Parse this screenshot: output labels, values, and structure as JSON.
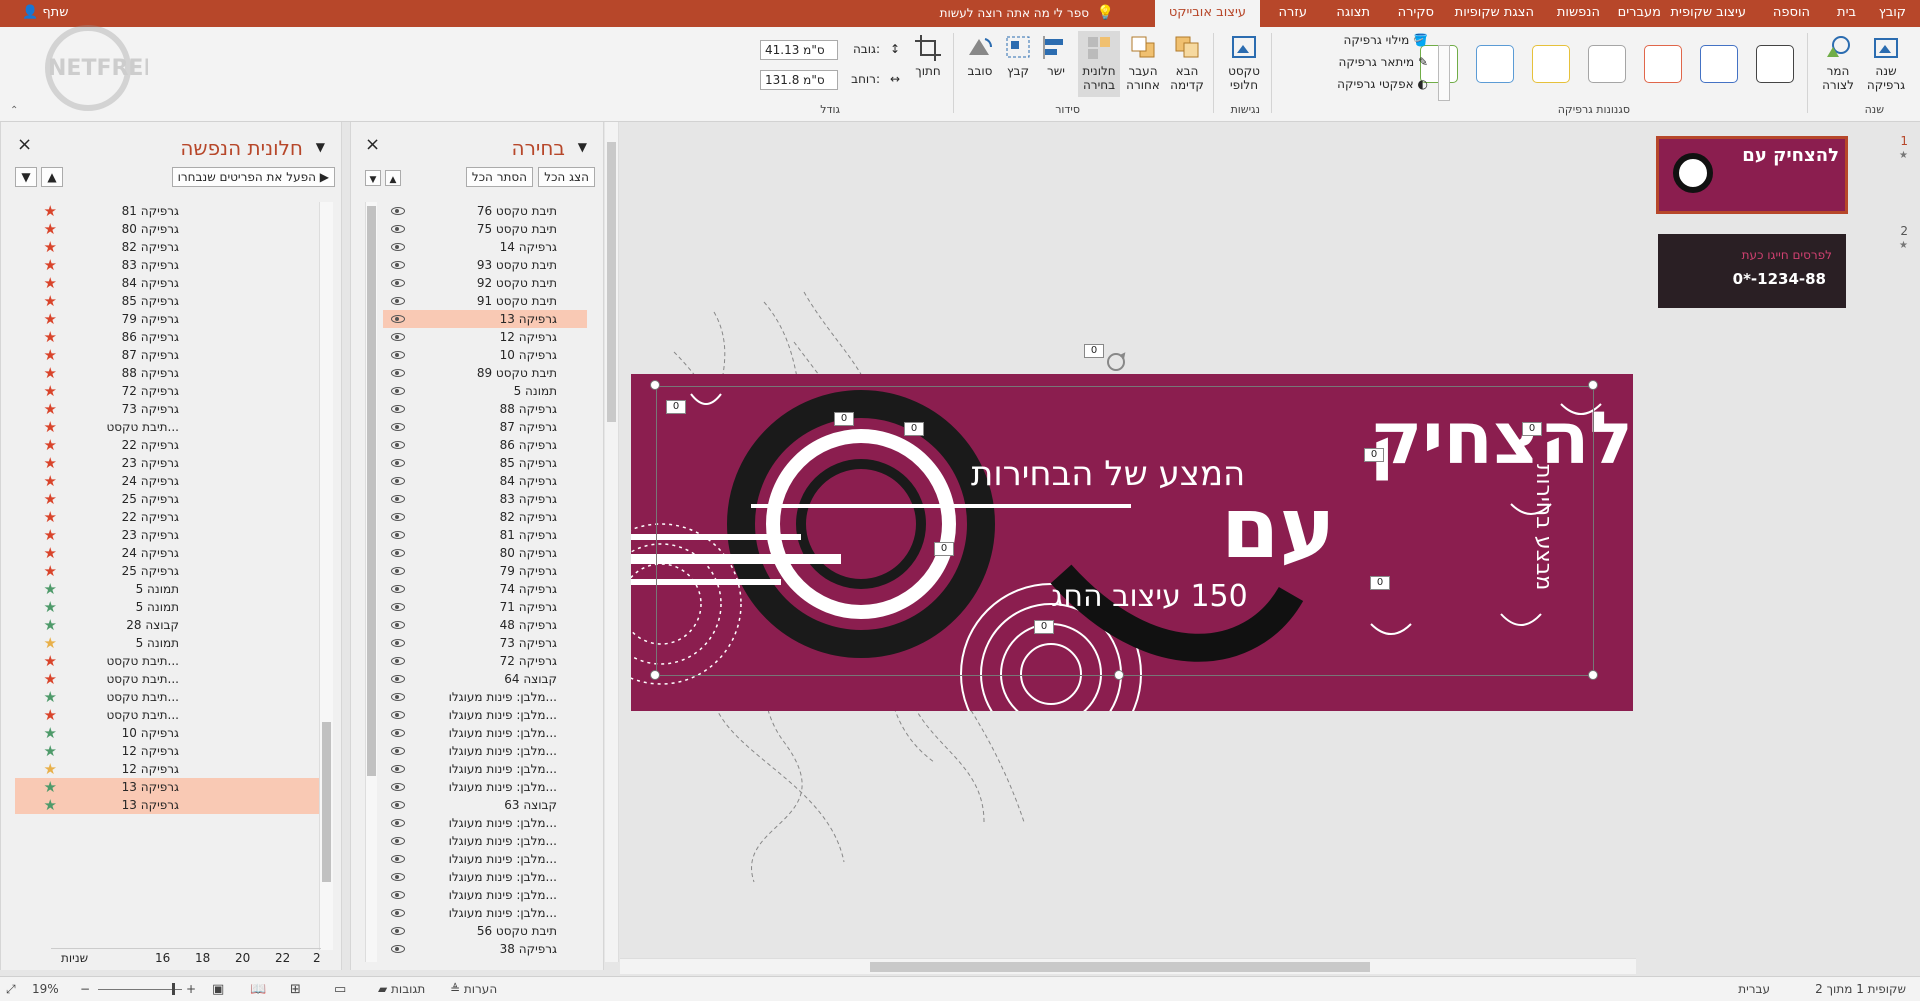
{
  "tabs": {
    "file": "קובץ",
    "home": "בית",
    "insert": "הוספה",
    "design": "עיצוב שקופית",
    "transitions": "מעברים",
    "animations": "הנפשות",
    "slideshow": "הצגת שקופיות",
    "review": "סקירה",
    "view": "תצוגה",
    "help": "עזרה",
    "format": "עיצוב אובייקט",
    "tell_me": "ספר לי מה אתה רוצה לעשות",
    "share": "שתף"
  },
  "ribbon": {
    "change_graphic": "שנה גרפיקה",
    "convert_to_shape": "המר לצורה",
    "change_group": "שנה",
    "fill": "מילוי גרפיקה",
    "outline": "מיתאר גרפיקה",
    "effects": "אפקטי גרפיקה",
    "styles_group": "סגנונות גרפיקה",
    "alt_text": "טקסט חלופי",
    "accessibility_group": "נגישות",
    "bring_forward": "הבא קדימה",
    "send_backward": "העבר אחורה",
    "selection_pane": "חלונית בחירה",
    "align": "ישר",
    "group": "קבץ",
    "rotate": "סובב",
    "arrange_group": "סידור",
    "crop": "חתוך",
    "height_label": "גובה:",
    "height_value": "41.13 ס\"מ",
    "width_label": "רוחב:",
    "width_value": "131.8 ס\"מ",
    "size_group": "גודל",
    "style_colors": [
      "#444444",
      "#4472c4",
      "#e0664a",
      "#a5a5a5",
      "#e6c13b",
      "#5b9bd5",
      "#70ad47"
    ]
  },
  "selection_pane": {
    "title": "בחירה",
    "show_all": "הצג הכל",
    "hide_all": "הסתר הכל",
    "items": [
      "תיבת טקסט 76",
      "תיבת טקסט 75",
      "גרפיקה 14",
      "תיבת טקסט 93",
      "תיבת טקסט 92",
      "תיבת טקסט 91",
      "גרפיקה 13",
      "גרפיקה 12",
      "גרפיקה 10",
      "תיבת טקסט 89",
      "תמונה 5",
      "גרפיקה 88",
      "גרפיקה 87",
      "גרפיקה 86",
      "גרפיקה 85",
      "גרפיקה 84",
      "גרפיקה 83",
      "גרפיקה 82",
      "גרפיקה 81",
      "גרפיקה 80",
      "גרפיקה 79",
      "גרפיקה 74",
      "גרפיקה 71",
      "גרפיקה 48",
      "גרפיקה 73",
      "גרפיקה 72",
      "קבוצה 64",
      "מלבן: פינות מעוגלו...",
      "מלבן: פינות מעוגלו...",
      "מלבן: פינות מעוגלו...",
      "מלבן: פינות מעוגלו...",
      "מלבן: פינות מעוגלו...",
      "מלבן: פינות מעוגלו...",
      "קבוצה 63",
      "מלבן: פינות מעוגלו...",
      "מלבן: פינות מעוגלו...",
      "מלבן: פינות מעוגלו...",
      "מלבן: פינות מעוגלו...",
      "מלבן: פינות מעוגלו...",
      "מלבן: פינות מעוגלו...",
      "תיבת טקסט 56",
      "גרפיקה 38"
    ],
    "selected_index": 6
  },
  "animation_pane": {
    "title": "חלונית הנפשה",
    "play_selected": "הפעל את הפריטים שנבחרו",
    "items": [
      {
        "label": "גרפיקה 81",
        "star": "#d9442b"
      },
      {
        "label": "גרפיקה 80",
        "star": "#d9442b"
      },
      {
        "label": "גרפיקה 82",
        "star": "#d9442b"
      },
      {
        "label": "גרפיקה 83",
        "star": "#d9442b"
      },
      {
        "label": "גרפיקה 84",
        "star": "#d9442b"
      },
      {
        "label": "גרפיקה 85",
        "star": "#d9442b"
      },
      {
        "label": "גרפיקה 79",
        "star": "#d9442b"
      },
      {
        "label": "גרפיקה 86",
        "star": "#d9442b"
      },
      {
        "label": "גרפיקה 87",
        "star": "#d9442b"
      },
      {
        "label": "גרפיקה 88",
        "star": "#d9442b"
      },
      {
        "label": "גרפיקה 72",
        "star": "#d9442b"
      },
      {
        "label": "גרפיקה 73",
        "star": "#d9442b"
      },
      {
        "label": "תיבת טקסט...",
        "star": "#d9442b"
      },
      {
        "label": "גרפיקה 22",
        "star": "#d9442b"
      },
      {
        "label": "גרפיקה 23",
        "star": "#d9442b"
      },
      {
        "label": "גרפיקה 24",
        "star": "#d9442b"
      },
      {
        "label": "גרפיקה 25",
        "star": "#d9442b"
      },
      {
        "label": "גרפיקה 22",
        "star": "#d9442b"
      },
      {
        "label": "גרפיקה 23",
        "star": "#d9442b"
      },
      {
        "label": "גרפיקה 24",
        "star": "#d9442b"
      },
      {
        "label": "גרפיקה 25",
        "star": "#d9442b"
      },
      {
        "label": "תמונה 5",
        "star": "#4e9a6a"
      },
      {
        "label": "תמונה 5",
        "star": "#4e9a6a"
      },
      {
        "label": "קבוצה 28",
        "star": "#4e9a6a"
      },
      {
        "label": "תמונה 5",
        "star": "#e8b04a"
      },
      {
        "label": "תיבת טקסט...",
        "star": "#d9442b"
      },
      {
        "label": "תיבת טקסט...",
        "star": "#d9442b"
      },
      {
        "label": "תיבת טקסט...",
        "star": "#4e9a6a"
      },
      {
        "label": "תיבת טקסט...",
        "star": "#d9442b"
      },
      {
        "label": "גרפיקה 10",
        "star": "#4e9a6a"
      },
      {
        "label": "גרפיקה 12",
        "star": "#4e9a6a"
      },
      {
        "label": "גרפיקה 12",
        "star": "#e8b04a"
      },
      {
        "label": "גרפיקה 13",
        "star": "#4e9a6a"
      },
      {
        "label": "גרפיקה 13",
        "star": "#4e9a6a"
      }
    ],
    "timeline_label": "שניות",
    "timeline_ticks": [
      "16",
      "18",
      "20",
      "22",
      "2"
    ]
  },
  "slide": {
    "title_line1": "להצחיק",
    "title_line2": "עם",
    "subtitle": "המצע של הבחירות",
    "side_text": "מבצע בחירות",
    "line3": "150 עיצוב החג",
    "small_label": "0"
  },
  "thumbnails": [
    {
      "number": "1",
      "star": "★",
      "text": "להצחיק עם"
    },
    {
      "number": "2",
      "star": "★",
      "line1": "לפרסים חייגו כעת",
      "line2": "0*-1234-88"
    }
  ],
  "status": {
    "slide_info": "שקופית 1 מתוך 2",
    "language": "עברית",
    "notes": "הערות",
    "comments": "תגובות",
    "zoom": "19%"
  },
  "watermark": "NETFREE"
}
